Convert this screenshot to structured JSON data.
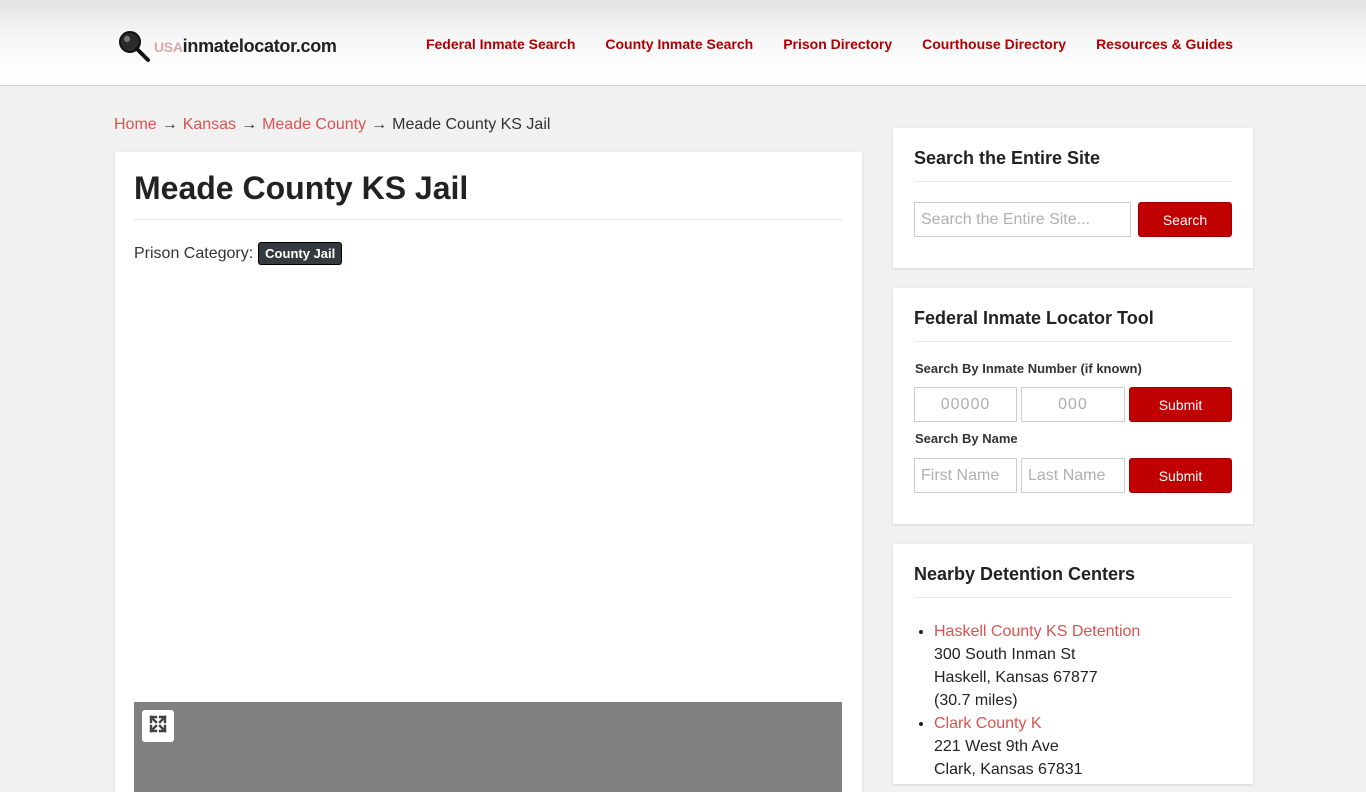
{
  "header": {
    "logo": {
      "prefix": "USA",
      "name": "inmatelocator.com"
    },
    "nav": [
      {
        "label": "Federal Inmate Search"
      },
      {
        "label": "County Inmate Search"
      },
      {
        "label": "Prison Directory"
      },
      {
        "label": "Courthouse Directory"
      },
      {
        "label": "Resources & Guides"
      }
    ]
  },
  "breadcrumb": {
    "items": [
      {
        "label": "Home"
      },
      {
        "label": "Kansas"
      },
      {
        "label": "Meade County"
      }
    ],
    "separator": "→",
    "current": "Meade County KS Jail"
  },
  "main": {
    "title": "Meade County KS Jail",
    "category_label": "Prison Category:",
    "category_badge": "County Jail"
  },
  "sidebar": {
    "site_search": {
      "title": "Search the Entire Site",
      "placeholder": "Search the Entire Site...",
      "button": "Search"
    },
    "federal_locator": {
      "title": "Federal Inmate Locator Tool",
      "by_number_label": "Search By Inmate Number (if known)",
      "number_part1_placeholder": "00000",
      "number_part2_placeholder": "000",
      "submit_number": "Submit",
      "by_name_label": "Search By Name",
      "first_name_placeholder": "First Name",
      "last_name_placeholder": "Last Name",
      "submit_name": "Submit"
    },
    "nearby": {
      "title": "Nearby Detention Centers",
      "items": [
        {
          "name": "Haskell County KS Detention",
          "street": "300 South Inman St",
          "city": "Haskell, Kansas 67877",
          "distance": "(30.7 miles)"
        },
        {
          "name": "Clark County K",
          "street": "221 West 9th Ave",
          "city": "Clark, Kansas 67831"
        }
      ]
    }
  },
  "colors": {
    "accent_red": "#b10000",
    "button_red": "#c00000",
    "link_red": "#d9534f",
    "badge_dark": "#343a40",
    "map_gray": "#808080"
  },
  "icons": {
    "logo": "magnifier-icon",
    "map_control": "expand-icon"
  }
}
